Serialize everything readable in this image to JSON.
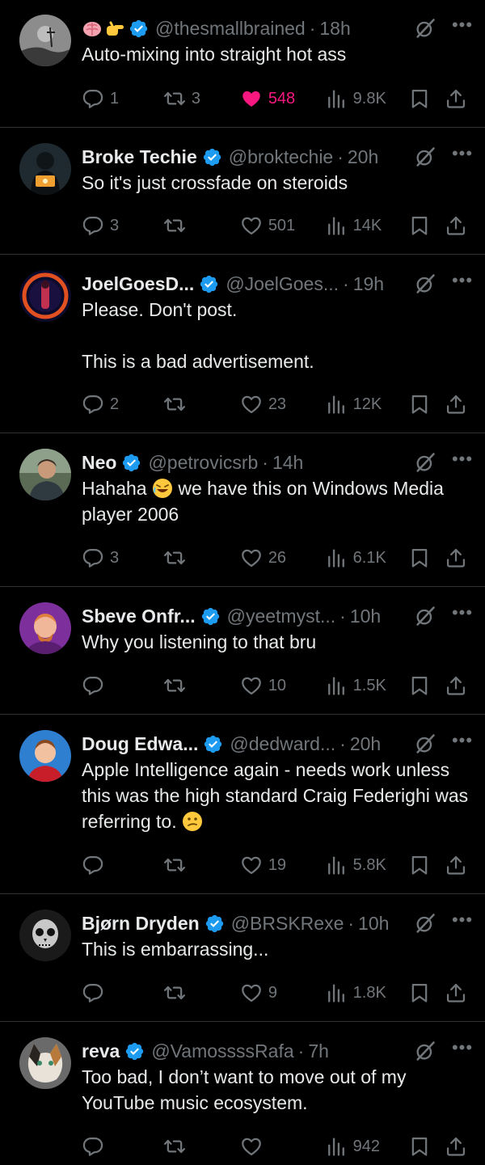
{
  "posts": [
    {
      "name": "",
      "name_emojis": [
        "brain-emoji",
        "pointing-hand-emoji"
      ],
      "handle": "@thesmallbrained",
      "time": "18h",
      "text": [
        "Auto-mixing into straight hot ass"
      ],
      "replies": "1",
      "reposts": "3",
      "likes": "548",
      "liked": true,
      "views": "9.8K"
    },
    {
      "name": "Broke Techie",
      "handle": "@broktechie",
      "time": "20h",
      "text": [
        "So it's just crossfade on steroids"
      ],
      "replies": "3",
      "reposts": "",
      "likes": "501",
      "views": "14K"
    },
    {
      "name": "JoelGoesD...",
      "handle": "@JoelGoes...",
      "time": "19h",
      "text": [
        "Please. Don't post.",
        "This is a bad advertisement."
      ],
      "replies": "2",
      "reposts": "",
      "likes": "23",
      "views": "12K"
    },
    {
      "name": "Neo",
      "handle": "@petrovicsrb",
      "time": "14h",
      "text": [
        "Hahaha",
        "we have this on Windows Media player 2006"
      ],
      "replies": "3",
      "reposts": "",
      "likes": "26",
      "views": "6.1K"
    },
    {
      "name": "Sbeve Onfr...",
      "handle": "@yeetmyst...",
      "time": "10h",
      "text": [
        "Why you listening to that bru"
      ],
      "replies": "",
      "reposts": "",
      "likes": "10",
      "views": "1.5K"
    },
    {
      "name": "Doug Edwa...",
      "handle": "@dedward...",
      "time": "20h",
      "text": [
        "Apple Intelligence again - needs work unless this was the high standard Craig Federighi was referring to."
      ],
      "replies": "",
      "reposts": "",
      "likes": "19",
      "views": "5.8K"
    },
    {
      "name": "Bjørn Dryden",
      "handle": "@BRSKRexe",
      "time": "10h",
      "text": [
        "This is embarrassing..."
      ],
      "replies": "",
      "reposts": "",
      "likes": "9",
      "views": "1.8K"
    },
    {
      "name": "reva",
      "handle": "@VamossssRafa",
      "time": "7h",
      "text": [
        "Too bad, I don’t want to move out of my YouTube music ecosystem."
      ],
      "replies": "",
      "reposts": "",
      "likes": "",
      "views": "942"
    }
  ],
  "colors": {
    "background": "#000000",
    "text": "#e7e9ea",
    "muted": "#71767b",
    "verified": "#1d9bf0",
    "like_active": "#f91880",
    "divider": "#2f3336"
  }
}
